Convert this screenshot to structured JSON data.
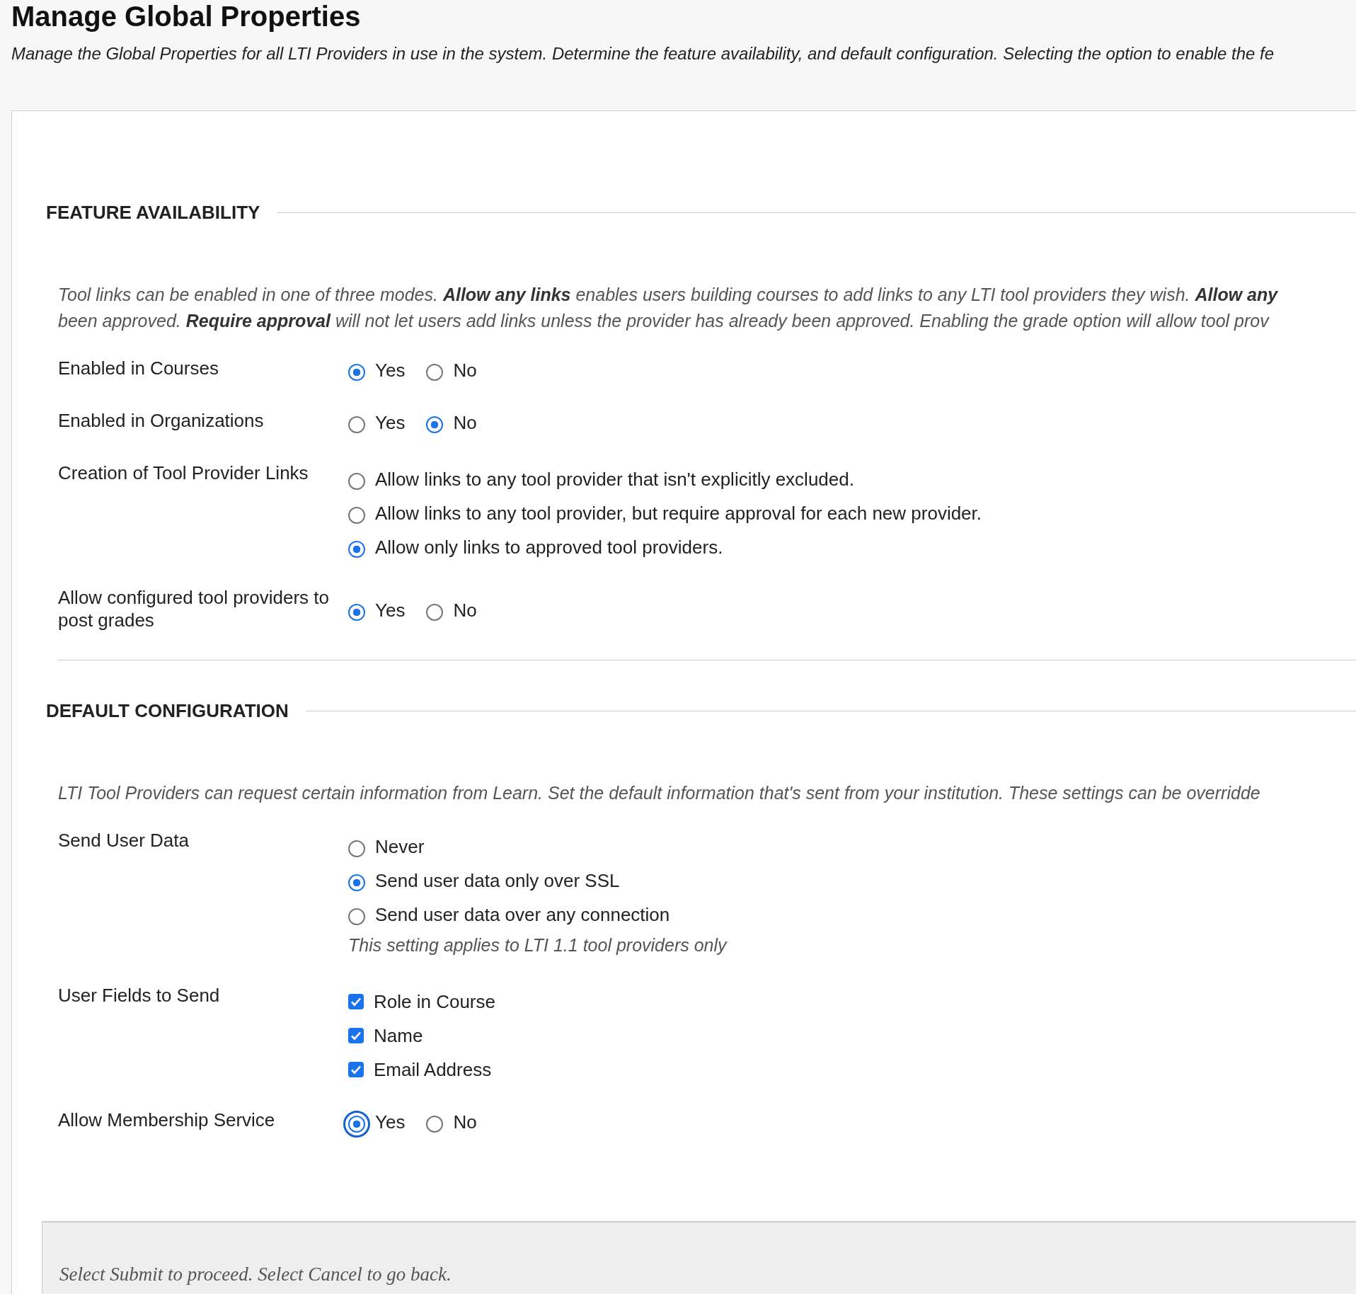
{
  "page": {
    "title": "Manage Global Properties",
    "description": "Manage the Global Properties for all LTI Providers in use in the system. Determine the feature availability, and default configuration. Selecting the option to enable the fe"
  },
  "sections": [
    {
      "heading": "FEATURE AVAILABILITY",
      "description_lines": [
        "Tool links can be enabled in one of three modes. **Allow any links** enables users building courses to add links to any LTI tool providers they wish. **Allow any**",
        "been approved. **Require approval** will not let users add links unless the provider has already been approved. Enabling the grade option will allow tool prov"
      ],
      "divider": true,
      "fields": [
        {
          "label": "Enabled in Courses",
          "kind": "radio-inline",
          "options": [
            {
              "label": "Yes",
              "selected": true
            },
            {
              "label": "No",
              "selected": false
            }
          ]
        },
        {
          "label": "Enabled in Organizations",
          "kind": "radio-inline",
          "options": [
            {
              "label": "Yes",
              "selected": false
            },
            {
              "label": "No",
              "selected": true
            }
          ]
        },
        {
          "label": "Creation of Tool Provider Links",
          "kind": "radio-list",
          "options": [
            {
              "label": "Allow links to any tool provider that isn't explicitly excluded.",
              "selected": false
            },
            {
              "label": "Allow links to any tool provider, but require approval for each new provider.",
              "selected": false
            },
            {
              "label": "Allow only links to approved tool providers.",
              "selected": true
            }
          ]
        },
        {
          "label": "Allow configured tool providers to post grades",
          "kind": "radio-inline",
          "options": [
            {
              "label": "Yes",
              "selected": true
            },
            {
              "label": "No",
              "selected": false
            }
          ]
        }
      ]
    },
    {
      "heading": "DEFAULT CONFIGURATION",
      "description_lines": [
        "LTI Tool Providers can request certain information from Learn. Set the default information that's sent from your institution. These settings can be overridde"
      ],
      "fields": [
        {
          "label": "Send User Data",
          "kind": "radio-list",
          "options": [
            {
              "label": "Never",
              "selected": false
            },
            {
              "label": "Send user data only over SSL",
              "selected": true
            },
            {
              "label": "Send user data over any connection",
              "selected": false
            }
          ],
          "note": "This setting applies to LTI 1.1 tool providers only"
        },
        {
          "label": "User Fields to Send",
          "kind": "checkbox-list",
          "options": [
            {
              "label": "Role in Course",
              "checked": true
            },
            {
              "label": "Name",
              "checked": true
            },
            {
              "label": "Email Address",
              "checked": true
            }
          ]
        },
        {
          "label": "Allow Membership Service",
          "kind": "radio-inline",
          "options": [
            {
              "label": "Yes",
              "selected": true,
              "focused": true
            },
            {
              "label": "No",
              "selected": false,
              "focused": false
            }
          ]
        }
      ]
    }
  ],
  "footer": {
    "text": "Select Submit to proceed. Select Cancel to go back."
  }
}
